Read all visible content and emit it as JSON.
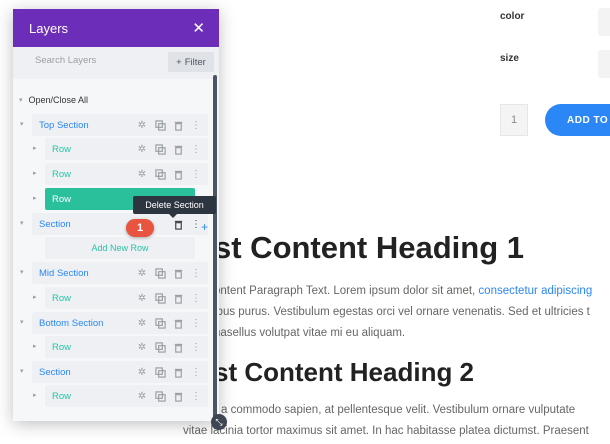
{
  "page": {
    "attrs": [
      {
        "label": "color"
      },
      {
        "label": "size"
      }
    ],
    "quantity": "1",
    "add_to_cart": "ADD TO C",
    "heading1": "st Content Heading 1",
    "para1": [
      {
        "text": "ontent Paragraph Text. Lorem ipsum dolor sit amet, ",
        "link": "consectetur adipiscing"
      },
      {
        "text": "ibus purus. Vestibulum egestas orci vel ornare venenatis. Sed et ultricies t"
      },
      {
        "text": "hasellus volutpat vitae mi eu aliquam."
      }
    ],
    "heading2": "st Content Heading 2",
    "para2": [
      "r a commodo sapien, at pellentesque velit. Vestibulum ornare vulputate",
      "vitae lacinia tortor maximus sit amet. In hac habitasse platea dictumst. Praesent"
    ]
  },
  "panel": {
    "title": "Layers",
    "search_placeholder": "Search Layers",
    "filter_label": "Filter",
    "open_close": "Open/Close All",
    "items": [
      {
        "label": "Top Section",
        "kind": "section"
      },
      {
        "label": "Row",
        "kind": "module"
      },
      {
        "label": "Row",
        "kind": "module"
      },
      {
        "label": "Row",
        "kind": "module",
        "active": true
      },
      {
        "label": "Section",
        "kind": "section"
      },
      {
        "label": "Mid Section",
        "kind": "section"
      },
      {
        "label": "Row",
        "kind": "module"
      },
      {
        "label": "Bottom Section",
        "kind": "section"
      },
      {
        "label": "Row",
        "kind": "module"
      },
      {
        "label": "Section",
        "kind": "section"
      },
      {
        "label": "Row",
        "kind": "module"
      }
    ],
    "add_new_row": "Add New Row",
    "tooltip": "Delete Section",
    "badge": "1"
  },
  "colors": {
    "header": "#6c2eb9",
    "section_text": "#2b87f5",
    "row_text": "#29c4a9",
    "active_row": "#2bc09c",
    "badge": "#e8543f"
  }
}
